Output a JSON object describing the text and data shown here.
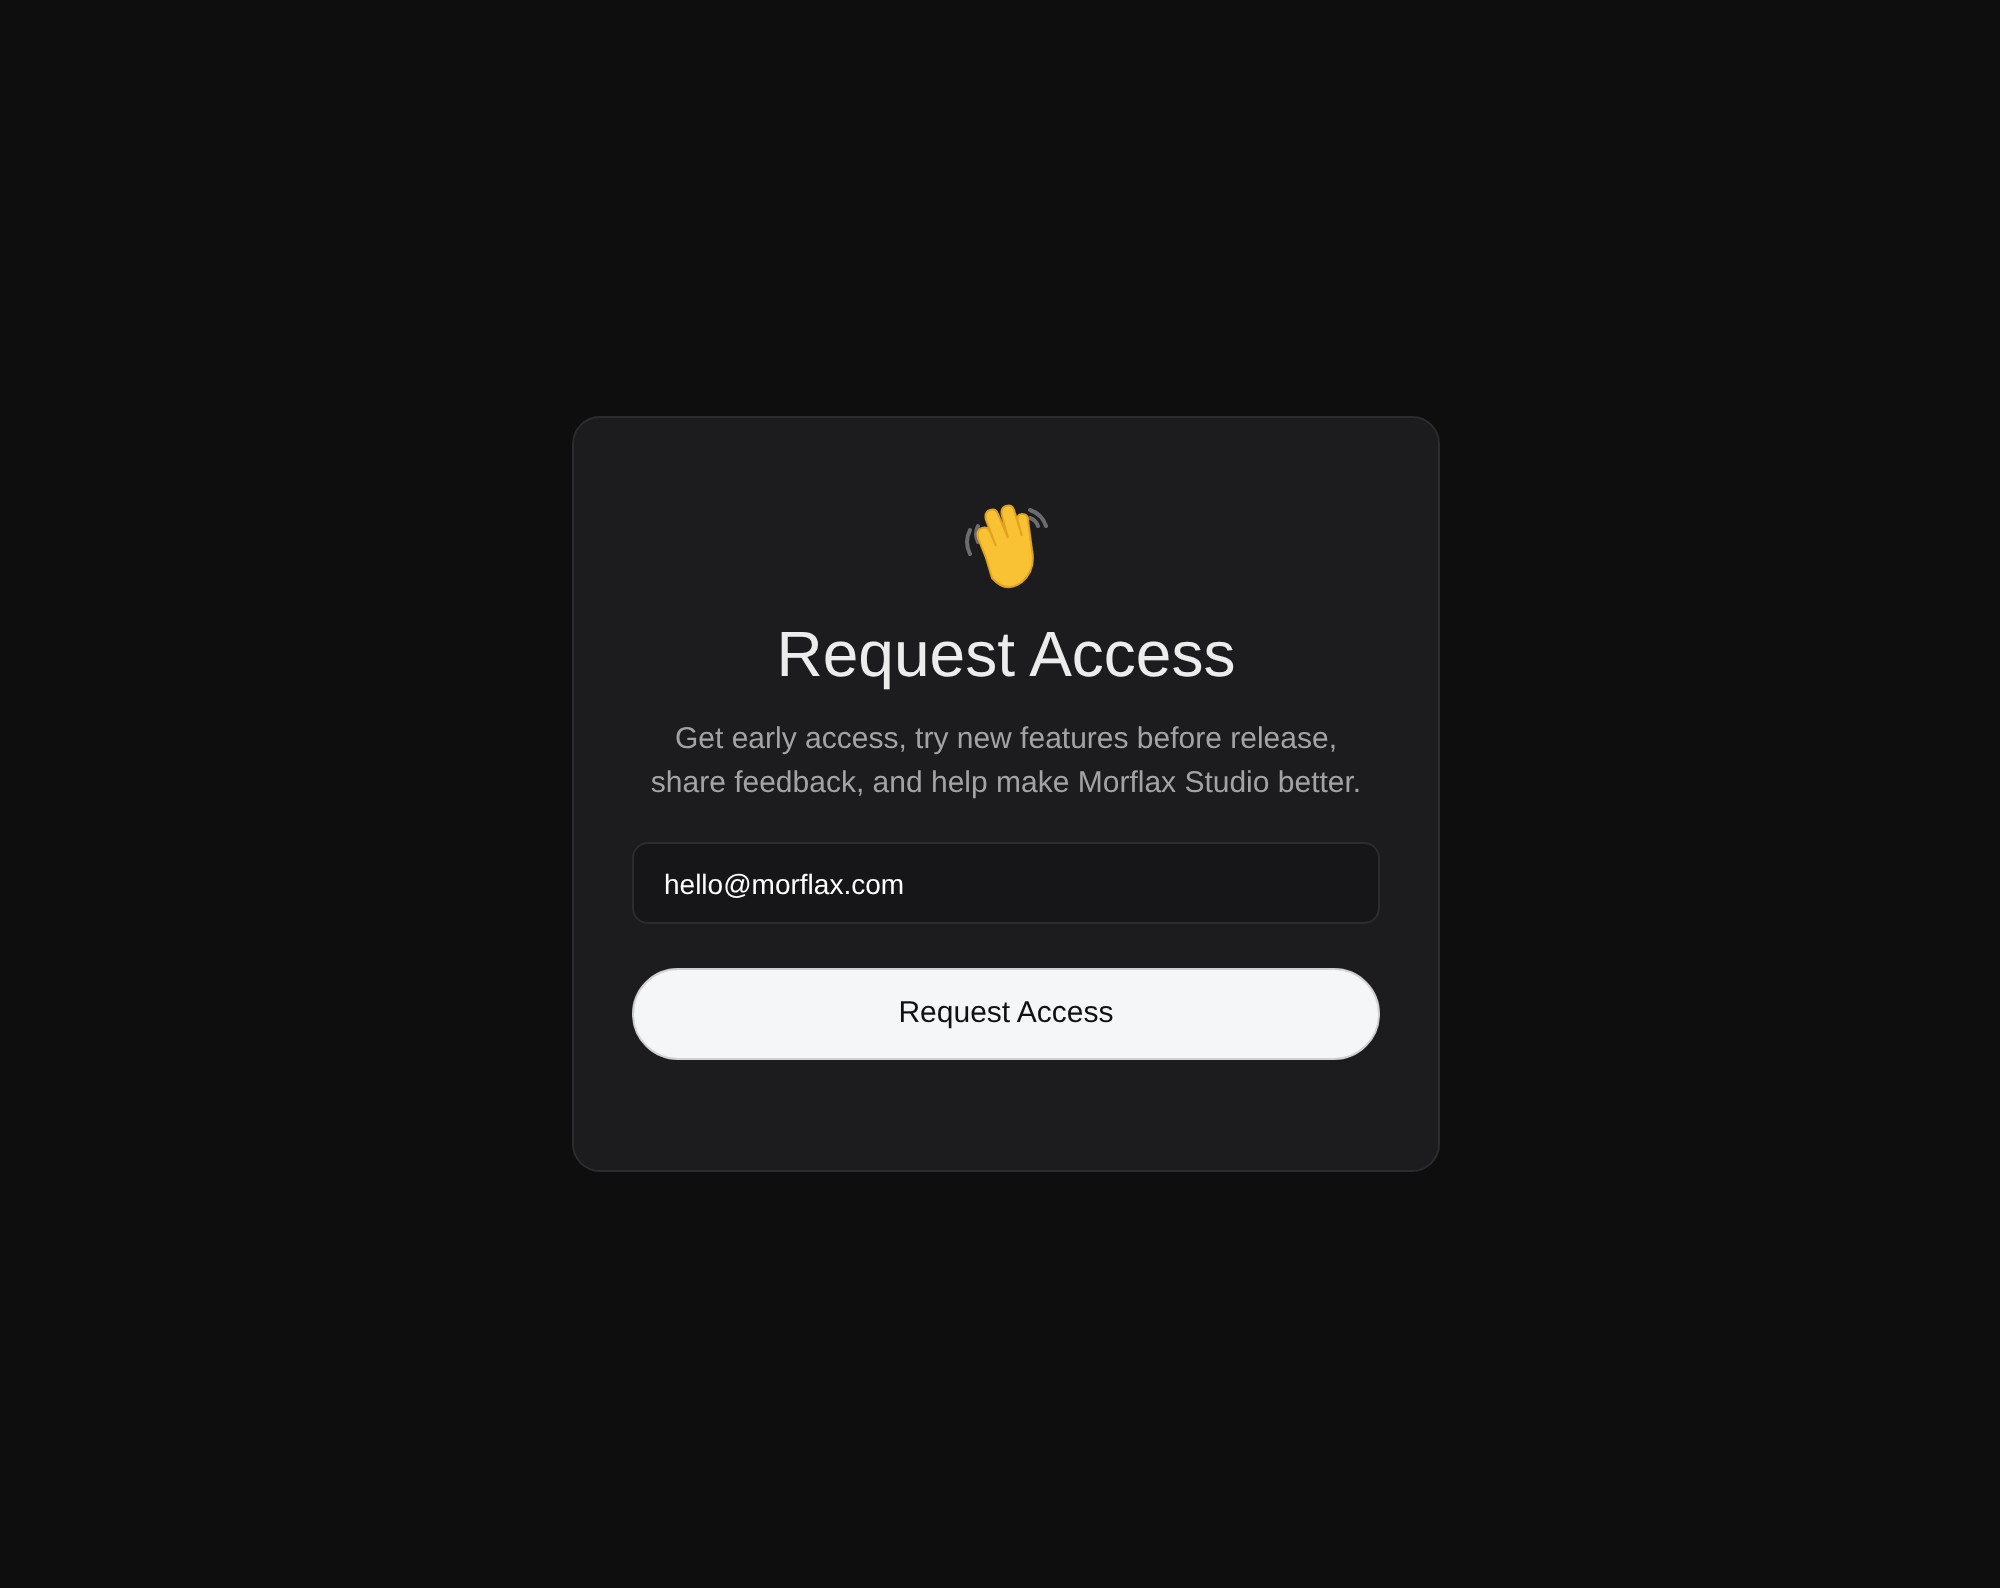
{
  "card": {
    "title": "Request Access",
    "description": "Get early access, try new features before release, share feedback, and help make Morflax Studio better.",
    "email_field": {
      "value": "hello@morflax.com"
    },
    "submit_button": {
      "label": "Request Access"
    }
  }
}
